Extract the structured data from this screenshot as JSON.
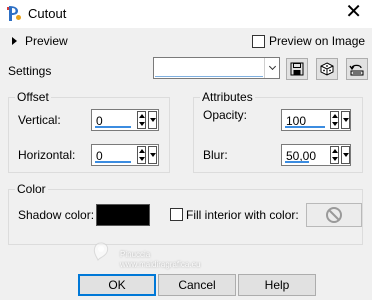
{
  "window": {
    "title": "Cutout",
    "close_glyph": "✕"
  },
  "preview": {
    "label": "Preview",
    "image_label": "Preview on Image"
  },
  "settings": {
    "label": "Settings",
    "value": ""
  },
  "offset": {
    "title": "Offset",
    "vertical_label": "Vertical:",
    "vertical_value": "0",
    "horizontal_label": "Horizontal:",
    "horizontal_value": "0"
  },
  "attributes": {
    "title": "Attributes",
    "opacity_label": "Opacity:",
    "opacity_value": "100",
    "blur_label": "Blur:",
    "blur_value": "50,00"
  },
  "color": {
    "title": "Color",
    "shadow_label": "Shadow color:",
    "shadow_color": "#000000",
    "fill_label": "Fill interior with color:"
  },
  "buttons": {
    "ok": "OK",
    "cancel": "Cancel",
    "help": "Help"
  },
  "watermark": {
    "line1": "Pinuccia",
    "line2": "www.maidiragrafica.eu"
  },
  "icons": [
    "app-icon",
    "close-icon",
    "save-icon",
    "randomize-icon",
    "reset-icon",
    "no-color-icon",
    "expand-arrow-icon"
  ]
}
